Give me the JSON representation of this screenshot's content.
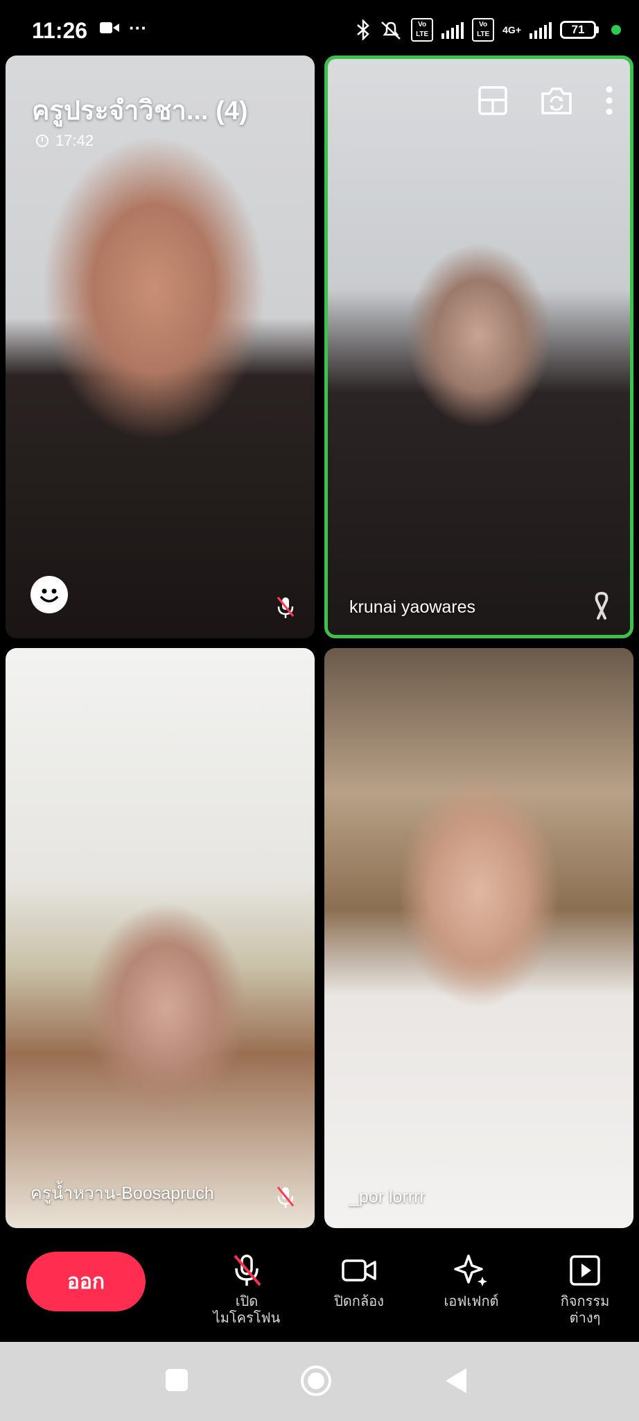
{
  "status_bar": {
    "time": "11:26",
    "extra": "···",
    "volte1": "Vo LTE",
    "volte2": "Vo LTE",
    "network": "4G+",
    "battery": "71",
    "accent_green": "#2ecc52"
  },
  "room": {
    "title": "ครูประจำวิชา... (4)",
    "elapsed": "17:42"
  },
  "participants": [
    {
      "name": "",
      "muted": true,
      "highlight": false
    },
    {
      "name": "krunai yaowares",
      "muted": false,
      "highlight": true,
      "highlight_color": "#3cc14d"
    },
    {
      "name": "ครูน้ำหวาน-Boosapruch",
      "muted": true,
      "highlight": false
    },
    {
      "name": "_por lorrrr",
      "muted": false,
      "highlight": false
    }
  ],
  "top_controls": [
    "layout-icon",
    "switch-camera-icon",
    "more-vert-icon"
  ],
  "bottom_bar": {
    "leave_label": "ออก",
    "leave_color": "#ff2d4f",
    "mic_label_line1": "เปิด",
    "mic_label_line2": "ไมโครโฟน",
    "camera_label": "ปิดกล้อง",
    "effects_label": "เอฟเฟกต์",
    "activities_label_line1": "กิจกรรม",
    "activities_label_line2": "ต่างๆ"
  }
}
